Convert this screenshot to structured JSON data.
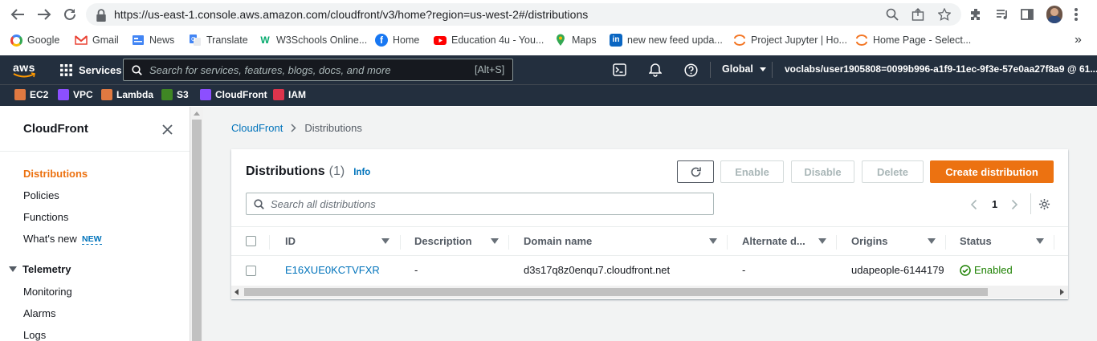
{
  "browser": {
    "url": "https://us-east-1.console.aws.amazon.com/cloudfront/v3/home?region=us-west-2#/distributions",
    "bookmarks": [
      {
        "label": "Google",
        "icon": "google-icon",
        "color": "#4285f4"
      },
      {
        "label": "Gmail",
        "icon": "gmail-icon",
        "color": "#ea4335"
      },
      {
        "label": "News",
        "icon": "news-icon",
        "color": "#4285f4"
      },
      {
        "label": "Translate",
        "icon": "translate-icon",
        "color": "#4285f4"
      },
      {
        "label": "W3Schools Online...",
        "icon": "w3schools-icon",
        "color": "#04aa6d"
      },
      {
        "label": "Home",
        "icon": "facebook-icon",
        "color": "#1877f2"
      },
      {
        "label": "Education 4u - You...",
        "icon": "youtube-icon",
        "color": "#ff0000"
      },
      {
        "label": "Maps",
        "icon": "maps-icon",
        "color": "#34a853"
      },
      {
        "label": "new new feed upda...",
        "icon": "linkedin-icon",
        "color": "#0a66c2"
      },
      {
        "label": "Project Jupyter | Ho...",
        "icon": "jupyter-icon",
        "color": "#f37726"
      },
      {
        "label": "Home Page - Select...",
        "icon": "jupyter-icon",
        "color": "#f37726"
      }
    ],
    "more_bookmarks": "»"
  },
  "aws": {
    "logo": "aws",
    "services_label": "Services",
    "search_placeholder": "Search for services, features, blogs, docs, and more",
    "search_shortcut": "[Alt+S]",
    "region": "Global",
    "account": "voclabs/user1905808=0099b996-a1f9-11ec-9f3e-57e0aa27f8a9 @ 61...",
    "favorites": [
      {
        "label": "EC2",
        "color": "#e07941"
      },
      {
        "label": "VPC",
        "color": "#8c4fff"
      },
      {
        "label": "Lambda",
        "color": "#e07941"
      },
      {
        "label": "S3",
        "color": "#3f8624"
      },
      {
        "label": "CloudFront",
        "color": "#8c4fff"
      },
      {
        "label": "IAM",
        "color": "#dd344c"
      }
    ]
  },
  "sidebar": {
    "title": "CloudFront",
    "items": [
      {
        "label": "Distributions"
      },
      {
        "label": "Policies"
      },
      {
        "label": "Functions"
      },
      {
        "label": "What's new",
        "badge": "NEW"
      }
    ],
    "section": "Telemetry",
    "section_items": [
      "Monitoring",
      "Alarms",
      "Logs"
    ]
  },
  "breadcrumb": {
    "root": "CloudFront",
    "current": "Distributions"
  },
  "panel": {
    "title": "Distributions",
    "count": "(1)",
    "info": "Info",
    "buttons": {
      "enable": "Enable",
      "disable": "Disable",
      "delete": "Delete",
      "create": "Create distribution"
    },
    "search_placeholder": "Search all distributions",
    "page": "1",
    "columns": [
      "ID",
      "Description",
      "Domain name",
      "Alternate d...",
      "Origins",
      "Status"
    ],
    "rows": [
      {
        "id": "E16XUE0KCTVFXR",
        "description": "-",
        "domain": "d3s17q8z0enqu7.cloudfront.net",
        "alternate": "-",
        "origins": "udapeople-6144179",
        "status": "Enabled"
      }
    ]
  },
  "colors": {
    "aws_orange": "#ec7211",
    "link": "#0073bb",
    "nav_bg": "#232f3e",
    "enabled": "#1d8102"
  }
}
